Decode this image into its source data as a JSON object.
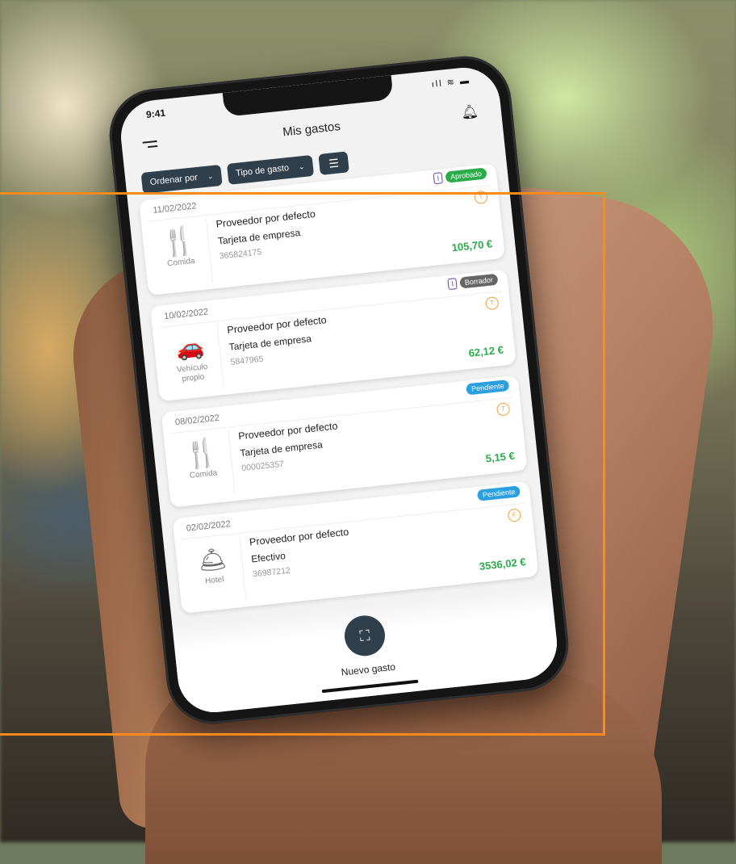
{
  "status_bar": {
    "time": "9:41",
    "icons": "ıll ≋ ▬"
  },
  "header": {
    "title": "Mis gastos"
  },
  "filters": {
    "sort_label": "Ordenar por",
    "type_label": "Tipo de gasto",
    "chevron": "⌄",
    "settings_glyph": "☰"
  },
  "expenses": [
    {
      "date": "11/02/2022",
      "report_badge": "I",
      "status": "Aprobado",
      "status_color": "#2bab4a",
      "category": "Comida",
      "category_icon": "🍴",
      "provider": "Proveedor por defecto",
      "payment": "Tarjeta de empresa",
      "reference": "365824175",
      "amount": "105,70 €",
      "coin": "T"
    },
    {
      "date": "10/02/2022",
      "report_badge": "I",
      "status": "Borrador",
      "status_color": "#666666",
      "category": "Vehículo\npropio",
      "category_icon": "🚗",
      "provider": "Proveedor por defecto",
      "payment": "Tarjeta de empresa",
      "reference": "5847965",
      "amount": "62,12 €",
      "coin": "T"
    },
    {
      "date": "08/02/2022",
      "report_badge": "",
      "status": "Pendiente",
      "status_color": "#2c9fe0",
      "category": "Comida",
      "category_icon": "🍴",
      "provider": "Proveedor por defecto",
      "payment": "Tarjeta de empresa",
      "reference": "000025357",
      "amount": "5,15 €",
      "coin": "T"
    },
    {
      "date": "02/02/2022",
      "report_badge": "",
      "status": "Pendiente",
      "status_color": "#2c9fe0",
      "category": "Hotel",
      "category_icon": "🛎",
      "provider": "Proveedor por defecto",
      "payment": "Efectivo",
      "reference": "36987212",
      "amount": "3536,02 €",
      "coin": "F"
    }
  ],
  "fab": {
    "glyph": "⛶",
    "label": "Nuevo gasto"
  },
  "colors": {
    "accent": "#2f3f4c",
    "amount": "#2bab4a",
    "frame": "#ff8a1c"
  }
}
